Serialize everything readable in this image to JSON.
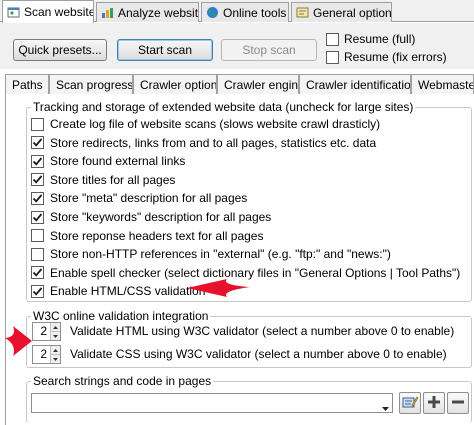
{
  "main_tabs": [
    {
      "label": "Scan website",
      "icon": "scan-icon"
    },
    {
      "label": "Analyze website",
      "icon": "analyze-icon"
    },
    {
      "label": "Online tools",
      "icon": "globe-icon"
    },
    {
      "label": "General options",
      "icon": "options-icon"
    }
  ],
  "toolbar": {
    "quick_presets_label": "Quick presets...",
    "start_scan_label": "Start scan",
    "stop_scan_label": "Stop scan",
    "resume_full_label": "Resume (full)",
    "resume_fix_label": "Resume (fix errors)",
    "resume_full_checked": false,
    "resume_fix_checked": false
  },
  "sub_tabs": [
    "Paths",
    "Scan progress",
    "Crawler options",
    "Crawler engine",
    "Crawler identification",
    "Webmaster filters"
  ],
  "tracking": {
    "title": "Tracking and storage of extended website data (uncheck for large sites)",
    "options": [
      {
        "label": "Create log file of website scans (slows website crawl drasticly)",
        "checked": false
      },
      {
        "label": "Store redirects, links from and to all pages, statistics etc. data",
        "checked": true
      },
      {
        "label": "Store found external links",
        "checked": true
      },
      {
        "label": "Store titles for all pages",
        "checked": true
      },
      {
        "label": "Store \"meta\" description for all pages",
        "checked": true
      },
      {
        "label": "Store \"keywords\" description for all pages",
        "checked": true
      },
      {
        "label": "Store reponse headers text for all pages",
        "checked": false
      },
      {
        "label": "Store non-HTTP references in \"external\" (e.g. \"ftp:\" and \"news:\")",
        "checked": false
      },
      {
        "label": "Enable spell checker (select dictionary files in \"General Options | Tool Paths\")",
        "checked": true
      },
      {
        "label": "Enable HTML/CSS validation",
        "checked": true
      }
    ]
  },
  "w3c": {
    "title": "W3C online validation integration",
    "html_value": "2",
    "html_label": "Validate HTML using W3C validator (select a number above 0 to enable)",
    "css_value": "2",
    "css_label": "Validate CSS using W3C validator (select a number above 0 to enable)"
  },
  "search": {
    "title": "Search strings and code in pages",
    "value": ""
  },
  "colors": {
    "annotation_arrow": "#e8112d",
    "check_mark": "#1a1a1a"
  }
}
